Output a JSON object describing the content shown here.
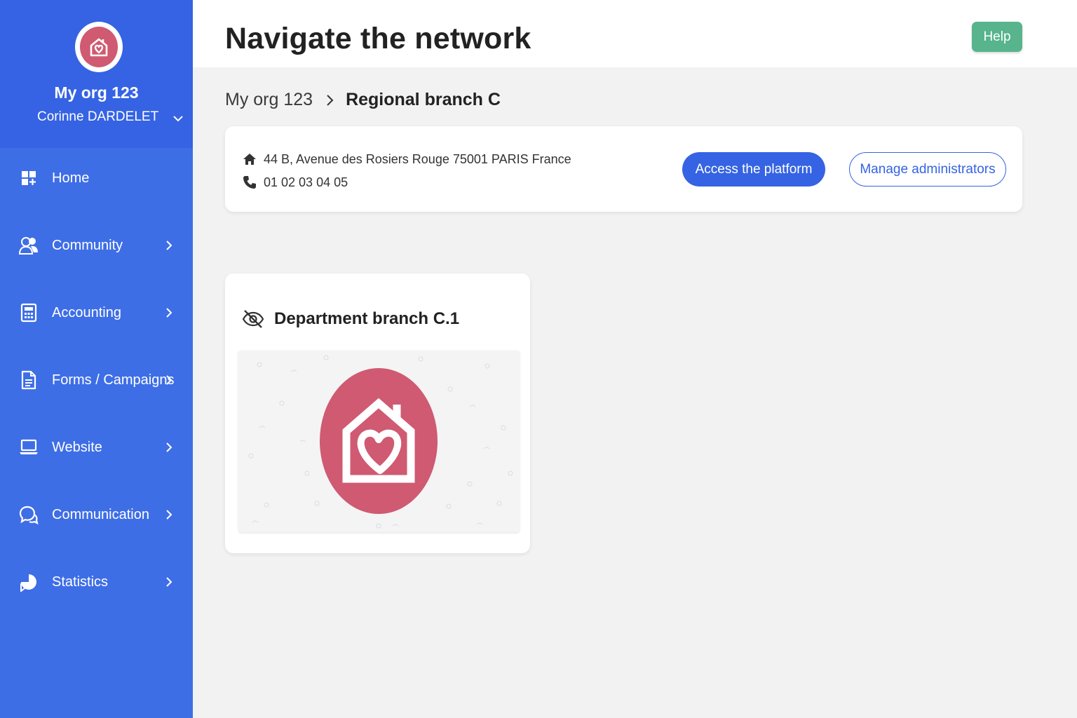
{
  "sidebar": {
    "org_name": "My org 123",
    "user_name": "Corinne DARDELET",
    "items": [
      {
        "label": "Home",
        "icon": "dashboard-icon",
        "has_submenu": false
      },
      {
        "label": "Community",
        "icon": "users-icon",
        "has_submenu": true
      },
      {
        "label": "Accounting",
        "icon": "calculator-icon",
        "has_submenu": true
      },
      {
        "label": "Forms / Campaigns",
        "icon": "document-icon",
        "has_submenu": true
      },
      {
        "label": "Website",
        "icon": "laptop-icon",
        "has_submenu": true
      },
      {
        "label": "Communication",
        "icon": "chat-bubbles-icon",
        "has_submenu": true
      },
      {
        "label": "Statistics",
        "icon": "pie-chart-icon",
        "has_submenu": true
      }
    ]
  },
  "header": {
    "title": "Navigate the network",
    "help_label": "Help"
  },
  "breadcrumb": {
    "root": "My org 123",
    "current": "Regional branch C"
  },
  "info_card": {
    "address": "44 B, Avenue des Rosiers Rouge 75001 PARIS France",
    "phone": "01 02 03 04 05",
    "access_label": "Access the platform",
    "manage_label": "Manage administrators"
  },
  "branches": [
    {
      "title": "Department branch C.1",
      "status_icon": "eye-off-icon",
      "logo": "house-heart-logo"
    }
  ],
  "colors": {
    "sidebar": "#3e6ee6",
    "sidebar_header": "#3563e3",
    "primary": "#3563e3",
    "help": "#57b48c",
    "logo": "#cf5a72"
  }
}
